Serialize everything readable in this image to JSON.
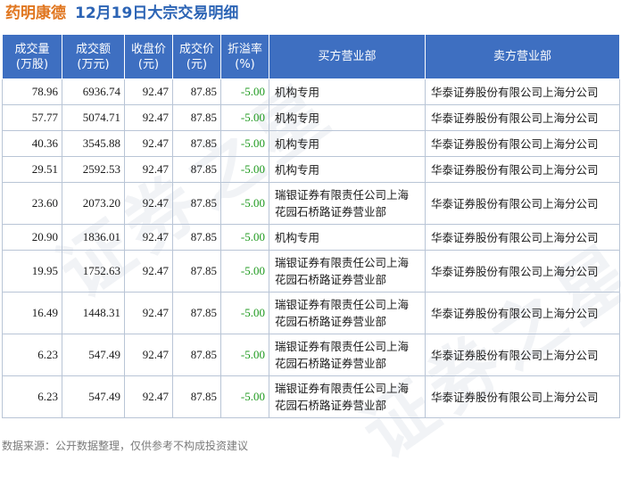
{
  "header": {
    "stock_name": "药明康德",
    "subtitle": "12月19日大宗交易明细"
  },
  "watermark": "证券之星",
  "table": {
    "columns": [
      {
        "line1": "成交量",
        "line2": "(万股)"
      },
      {
        "line1": "成交额",
        "line2": "(万元)"
      },
      {
        "line1": "收盘价",
        "line2": "(元)"
      },
      {
        "line1": "成交价",
        "line2": "(元)"
      },
      {
        "line1": "折溢率",
        "line2": "(%)"
      },
      {
        "line1": "买方营业部",
        "line2": ""
      },
      {
        "line1": "卖方营业部",
        "line2": ""
      }
    ],
    "rows": [
      {
        "volume": "78.96",
        "amount": "6936.74",
        "close": "92.47",
        "price": "87.85",
        "premium": "-5.00",
        "buyer_line1": "机构专用",
        "buyer_line2": "",
        "seller": "华泰证券股份有限公司上海分公司"
      },
      {
        "volume": "57.77",
        "amount": "5074.71",
        "close": "92.47",
        "price": "87.85",
        "premium": "-5.00",
        "buyer_line1": "机构专用",
        "buyer_line2": "",
        "seller": "华泰证券股份有限公司上海分公司"
      },
      {
        "volume": "40.36",
        "amount": "3545.88",
        "close": "92.47",
        "price": "87.85",
        "premium": "-5.00",
        "buyer_line1": "机构专用",
        "buyer_line2": "",
        "seller": "华泰证券股份有限公司上海分公司"
      },
      {
        "volume": "29.51",
        "amount": "2592.53",
        "close": "92.47",
        "price": "87.85",
        "premium": "-5.00",
        "buyer_line1": "机构专用",
        "buyer_line2": "",
        "seller": "华泰证券股份有限公司上海分公司"
      },
      {
        "volume": "23.60",
        "amount": "2073.20",
        "close": "92.47",
        "price": "87.85",
        "premium": "-5.00",
        "buyer_line1": "瑞银证券有限责任公司上海",
        "buyer_line2": "花园石桥路证券营业部",
        "seller": "华泰证券股份有限公司上海分公司"
      },
      {
        "volume": "20.90",
        "amount": "1836.01",
        "close": "92.47",
        "price": "87.85",
        "premium": "-5.00",
        "buyer_line1": "机构专用",
        "buyer_line2": "",
        "seller": "华泰证券股份有限公司上海分公司"
      },
      {
        "volume": "19.95",
        "amount": "1752.63",
        "close": "92.47",
        "price": "87.85",
        "premium": "-5.00",
        "buyer_line1": "瑞银证券有限责任公司上海",
        "buyer_line2": "花园石桥路证券营业部",
        "seller": "华泰证券股份有限公司上海分公司"
      },
      {
        "volume": "16.49",
        "amount": "1448.31",
        "close": "92.47",
        "price": "87.85",
        "premium": "-5.00",
        "buyer_line1": "瑞银证券有限责任公司上海",
        "buyer_line2": "花园石桥路证券营业部",
        "seller": "华泰证券股份有限公司上海分公司"
      },
      {
        "volume": "6.23",
        "amount": "547.49",
        "close": "92.47",
        "price": "87.85",
        "premium": "-5.00",
        "buyer_line1": "瑞银证券有限责任公司上海",
        "buyer_line2": "花园石桥路证券营业部",
        "seller": "华泰证券股份有限公司上海分公司"
      },
      {
        "volume": "6.23",
        "amount": "547.49",
        "close": "92.47",
        "price": "87.85",
        "premium": "-5.00",
        "buyer_line1": "瑞银证券有限责任公司上海",
        "buyer_line2": "花园石桥路证券营业部",
        "seller": "华泰证券股份有限公司上海分公司"
      }
    ]
  },
  "footer": {
    "source_note": "数据来源：公开数据整理，仅供参考不构成投资建议"
  },
  "colors": {
    "header_bg": "#3e6fc1",
    "title_orange": "#e0761f",
    "title_blue": "#2c64b5",
    "premium_green": "#1f9a1f"
  }
}
